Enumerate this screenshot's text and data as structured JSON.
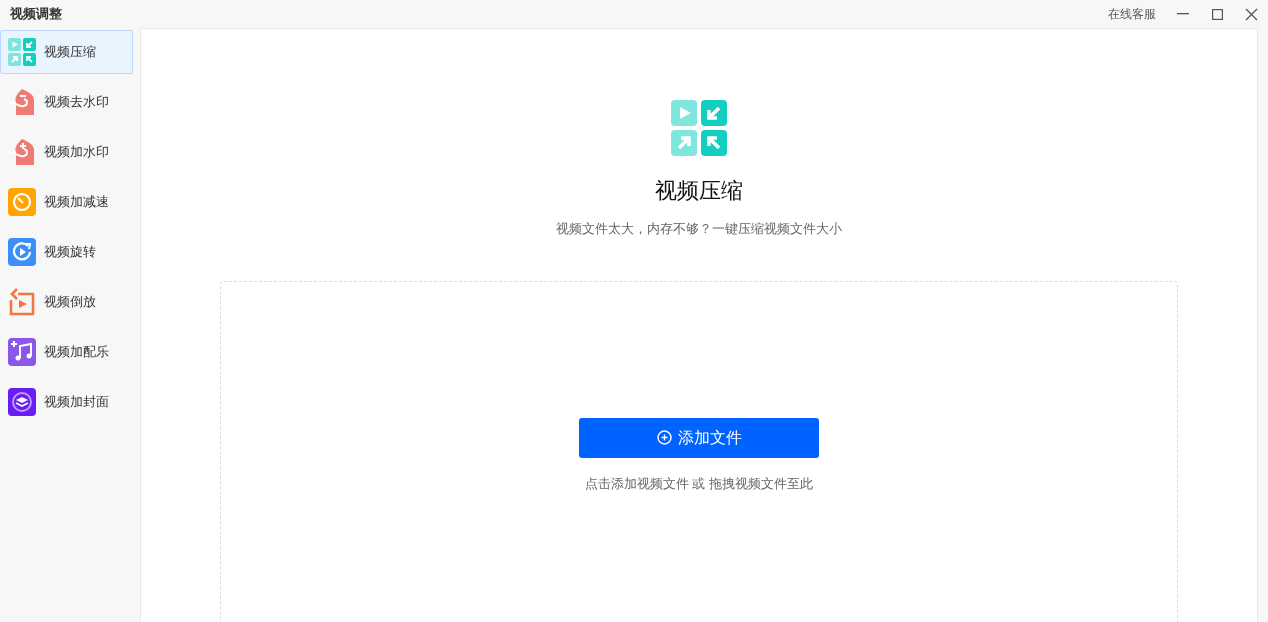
{
  "window": {
    "title": "视频调整",
    "service_link": "在线客服"
  },
  "sidebar": {
    "items": [
      {
        "label": "视频压缩",
        "kind": "compress",
        "selected": true
      },
      {
        "label": "视频去水印",
        "kind": "remove-watermark",
        "selected": false
      },
      {
        "label": "视频加水印",
        "kind": "add-watermark",
        "selected": false
      },
      {
        "label": "视频加减速",
        "kind": "speed",
        "selected": false
      },
      {
        "label": "视频旋转",
        "kind": "rotate",
        "selected": false
      },
      {
        "label": "视频倒放",
        "kind": "reverse",
        "selected": false
      },
      {
        "label": "视频加配乐",
        "kind": "music",
        "selected": false
      },
      {
        "label": "视频加封面",
        "kind": "cover",
        "selected": false
      }
    ]
  },
  "main": {
    "title": "视频压缩",
    "subtitle": "视频文件太大，内存不够？一键压缩视频文件大小",
    "add_button": "添加文件",
    "hint": "点击添加视频文件 或 拖拽视频文件至此"
  }
}
